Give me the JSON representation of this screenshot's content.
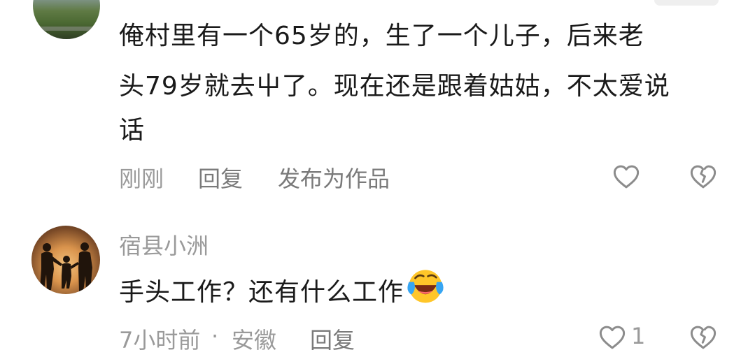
{
  "comment1": {
    "lines": [
      "俺村里有一个65岁的，生了一个儿子，后来老",
      "头79岁就去屮了。现在还是跟着姑姑，不太爱说",
      "话"
    ],
    "time": "刚刚",
    "reply_label": "回复",
    "publish_label": "发布为作品"
  },
  "comment2": {
    "username": "宿县小洲",
    "text": "手头工作？还有什么工作",
    "emoji": "face-with-tears-of-joy",
    "time": "7小时前",
    "separator": "·",
    "location": "安徽",
    "reply_label": "回复",
    "like_count": "1"
  },
  "colors": {
    "text": "#1a1a1a",
    "muted": "#9a9a9a",
    "icon": "#8c8c8c",
    "background": "#ffffff"
  }
}
